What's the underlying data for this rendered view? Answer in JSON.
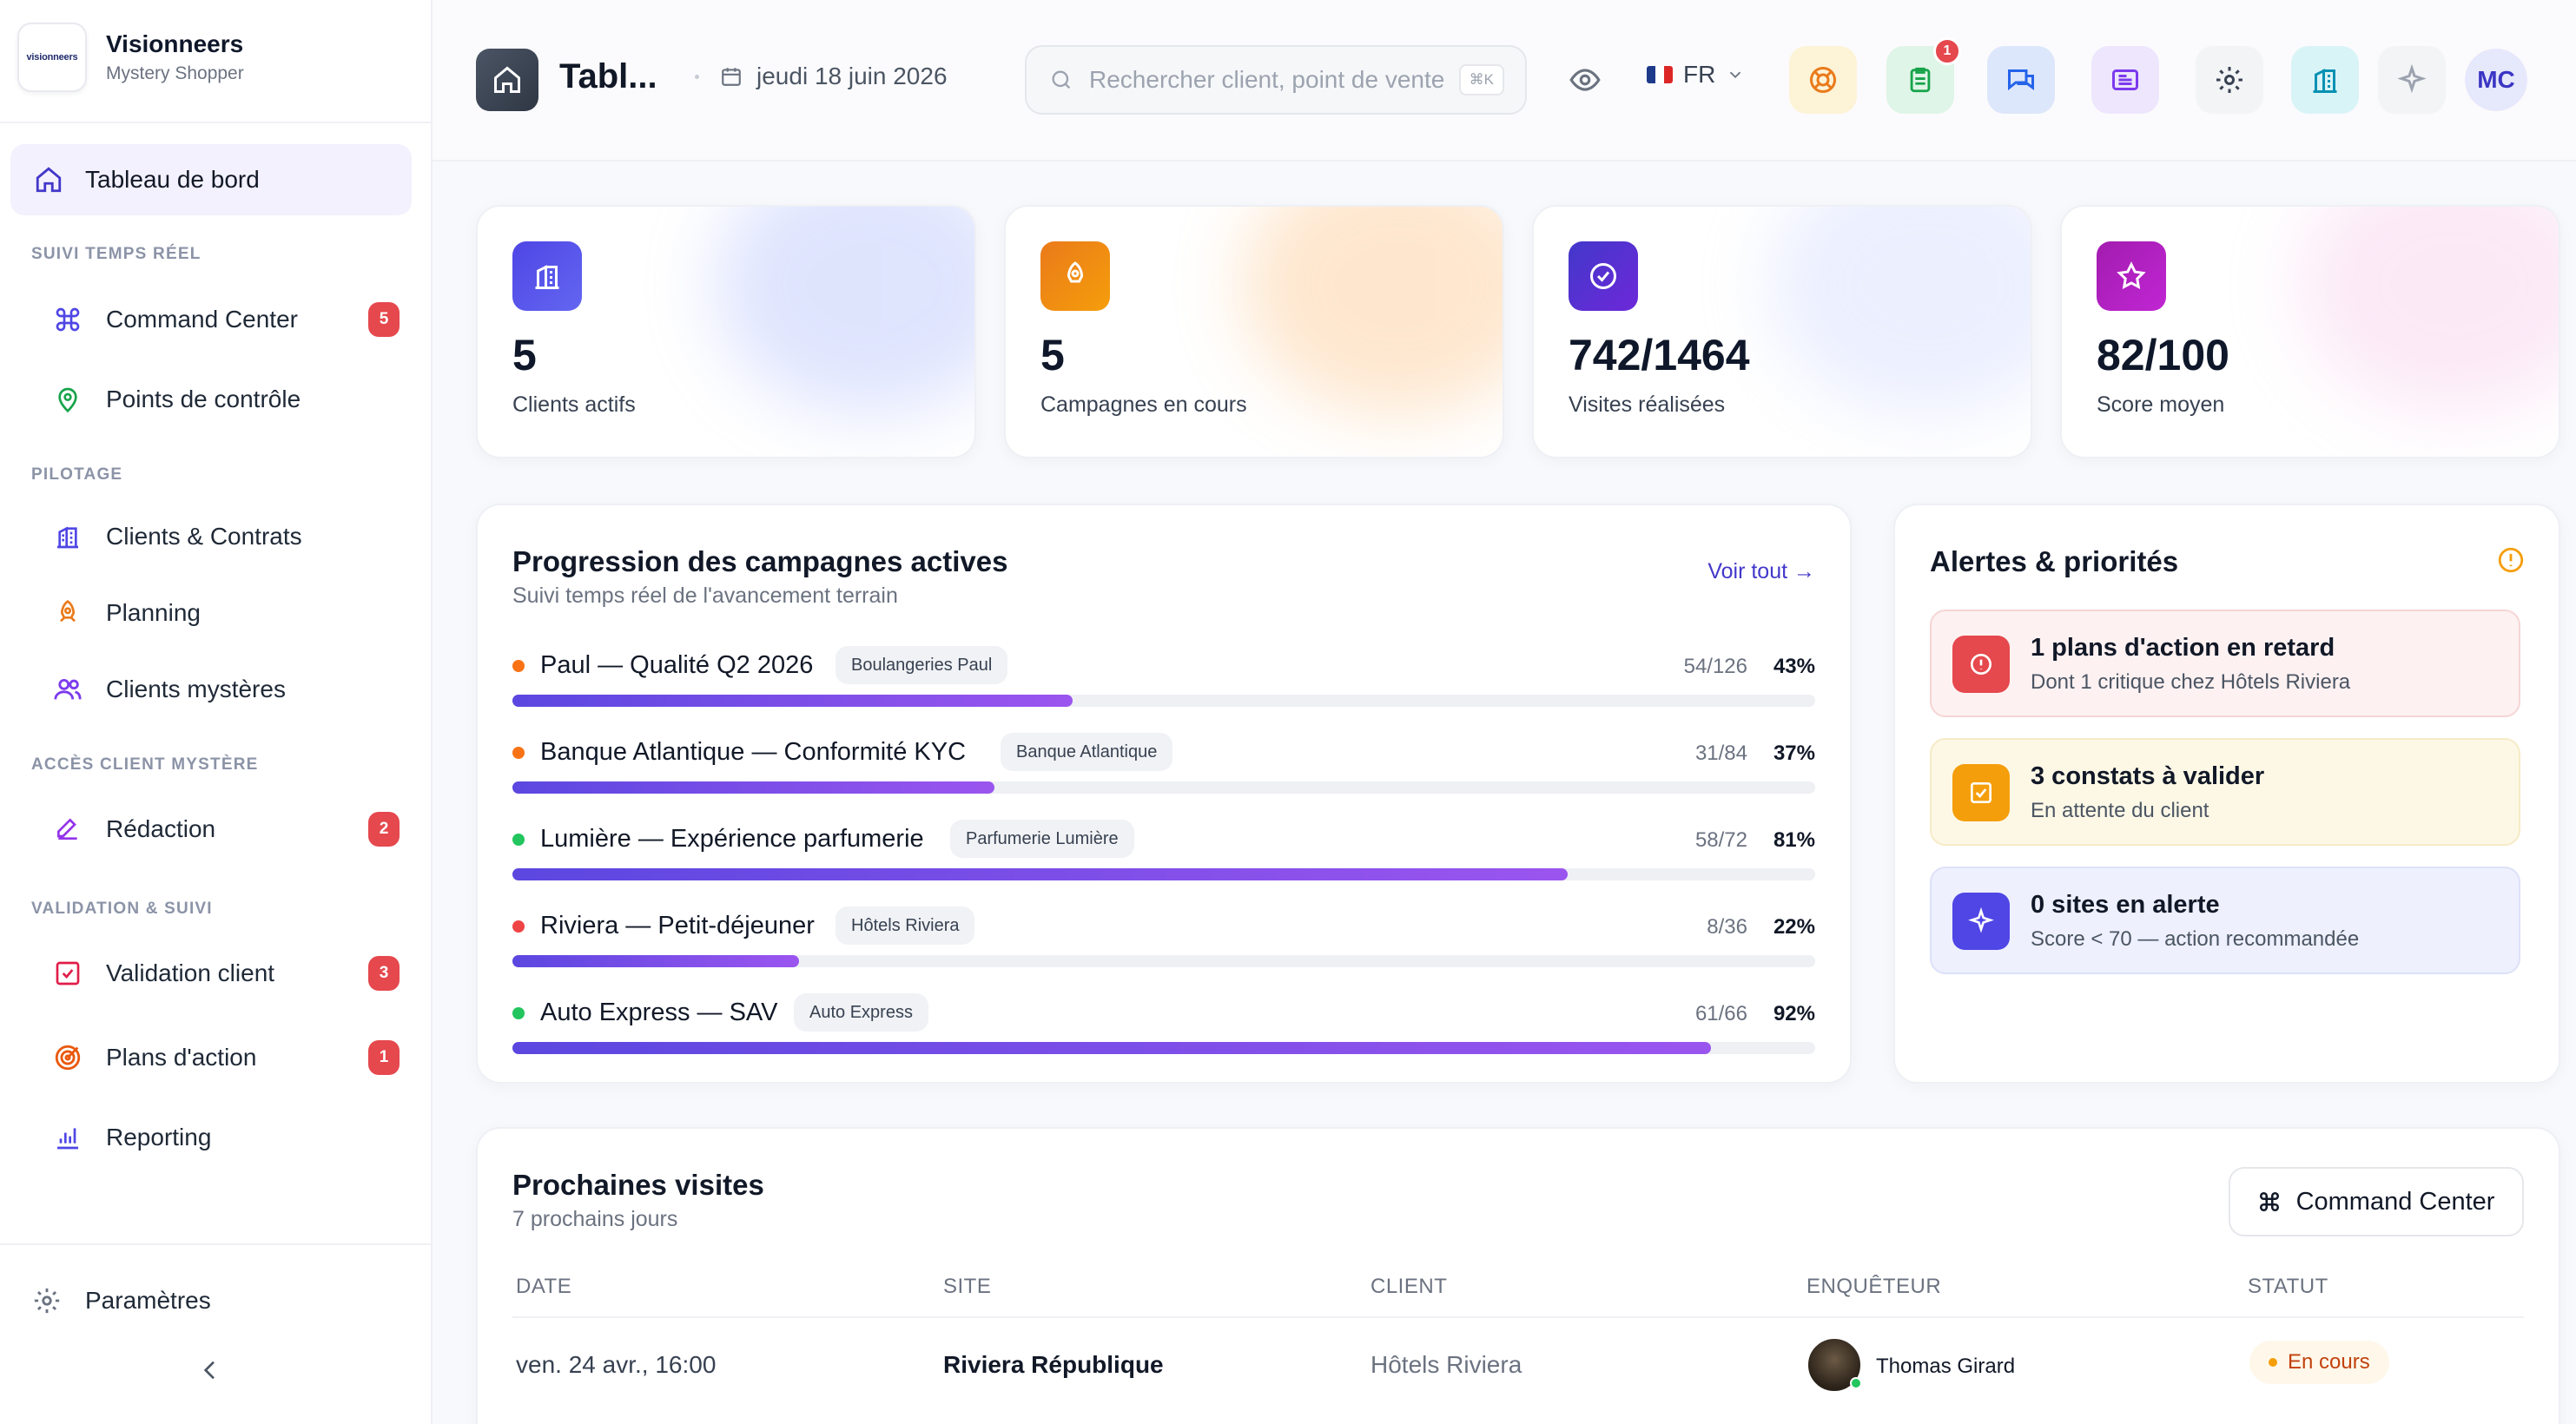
{
  "brand": {
    "logo_text": "visionneers",
    "name": "Visionneers",
    "subtitle": "Mystery Shopper"
  },
  "sidebar": {
    "active": {
      "label": "Tableau de bord",
      "icon": "home-icon"
    },
    "sections": [
      {
        "title": "SUIVI TEMPS RÉEL"
      },
      {
        "title": "PILOTAGE"
      },
      {
        "title": "ACCÈS CLIENT MYSTÈRE"
      },
      {
        "title": "VALIDATION & SUIVI"
      }
    ],
    "items": [
      {
        "label": "Command Center",
        "icon": "command-icon",
        "badge": "5"
      },
      {
        "label": "Points de contrôle",
        "icon": "map-pin-icon"
      },
      {
        "label": "Clients & Contrats",
        "icon": "building-icon"
      },
      {
        "label": "Planning",
        "icon": "rocket-icon"
      },
      {
        "label": "Clients mystères",
        "icon": "users-icon"
      },
      {
        "label": "Rédaction",
        "icon": "pen-icon",
        "badge": "2"
      },
      {
        "label": "Validation client",
        "icon": "checkbox-icon",
        "badge": "3"
      },
      {
        "label": "Plans d'action",
        "icon": "target-icon",
        "badge": "1"
      },
      {
        "label": "Reporting",
        "icon": "bar-chart-icon"
      }
    ],
    "settings_label": "Paramètres",
    "collapse_icon": "chevron-left-icon"
  },
  "header": {
    "title": "Tabl...",
    "date": "jeudi 18 juin 2026",
    "search_placeholder": "Rechercher client, point de vente...",
    "shortcut": "⌘K",
    "language": "FR",
    "notification_count": "1",
    "avatar_initials": "MC"
  },
  "kpis": [
    {
      "value": "5",
      "label": "Clients actifs",
      "icon": "building-icon",
      "color": "#4f46e5"
    },
    {
      "value": "5",
      "label": "Campagnes en cours",
      "icon": "rocket-icon",
      "color": "#ea7a1a"
    },
    {
      "value": "742/1464",
      "label": "Visites réalisées",
      "icon": "check-circle-icon",
      "color": "#4338ca"
    },
    {
      "value": "82/100",
      "label": "Score moyen",
      "icon": "star-icon",
      "color": "#b83fc0"
    }
  ],
  "progress": {
    "title": "Progression des campagnes actives",
    "subtitle": "Suivi temps réel de l'avancement terrain",
    "link": "Voir tout →",
    "campaigns": [
      {
        "name": "Paul — Qualité Q2 2026",
        "client": "Boulangeries Paul",
        "done": "54/126",
        "percent": "43%",
        "value": 43,
        "dot": "#f97316"
      },
      {
        "name": "Banque Atlantique — Conformité KYC",
        "client": "Banque Atlantique",
        "done": "31/84",
        "percent": "37%",
        "value": 37,
        "dot": "#f97316"
      },
      {
        "name": "Lumière — Expérience parfumerie",
        "client": "Parfumerie Lumière",
        "done": "58/72",
        "percent": "81%",
        "value": 81,
        "dot": "#22c55e"
      },
      {
        "name": "Riviera — Petit-déjeuner",
        "client": "Hôtels Riviera",
        "done": "8/36",
        "percent": "22%",
        "value": 22,
        "dot": "#ef4444"
      },
      {
        "name": "Auto Express — SAV",
        "client": "Auto Express",
        "done": "61/66",
        "percent": "92%",
        "value": 92,
        "dot": "#22c55e"
      }
    ]
  },
  "alerts": {
    "title": "Alertes & priorités",
    "items": [
      {
        "title": "1 plans d'action en retard",
        "subtitle": "Dont 1 critique chez Hôtels Riviera",
        "icon": "alert-circle-icon"
      },
      {
        "title": "3 constats à valider",
        "subtitle": "En attente du client",
        "icon": "checkbox-icon"
      },
      {
        "title": "0 sites en alerte",
        "subtitle": "Score < 70 — action recommandée",
        "icon": "sparkle-icon"
      }
    ]
  },
  "visits": {
    "title": "Prochaines visites",
    "subtitle": "7 prochains jours",
    "button": "Command Center",
    "columns": [
      "DATE",
      "SITE",
      "CLIENT",
      "ENQUÊTEUR",
      "STATUT"
    ],
    "rows": [
      {
        "date": "ven. 24 avr., 16:00",
        "site": "Riviera République",
        "client": "Hôtels Riviera",
        "agent": "Thomas Girard",
        "status": "En cours"
      }
    ]
  }
}
